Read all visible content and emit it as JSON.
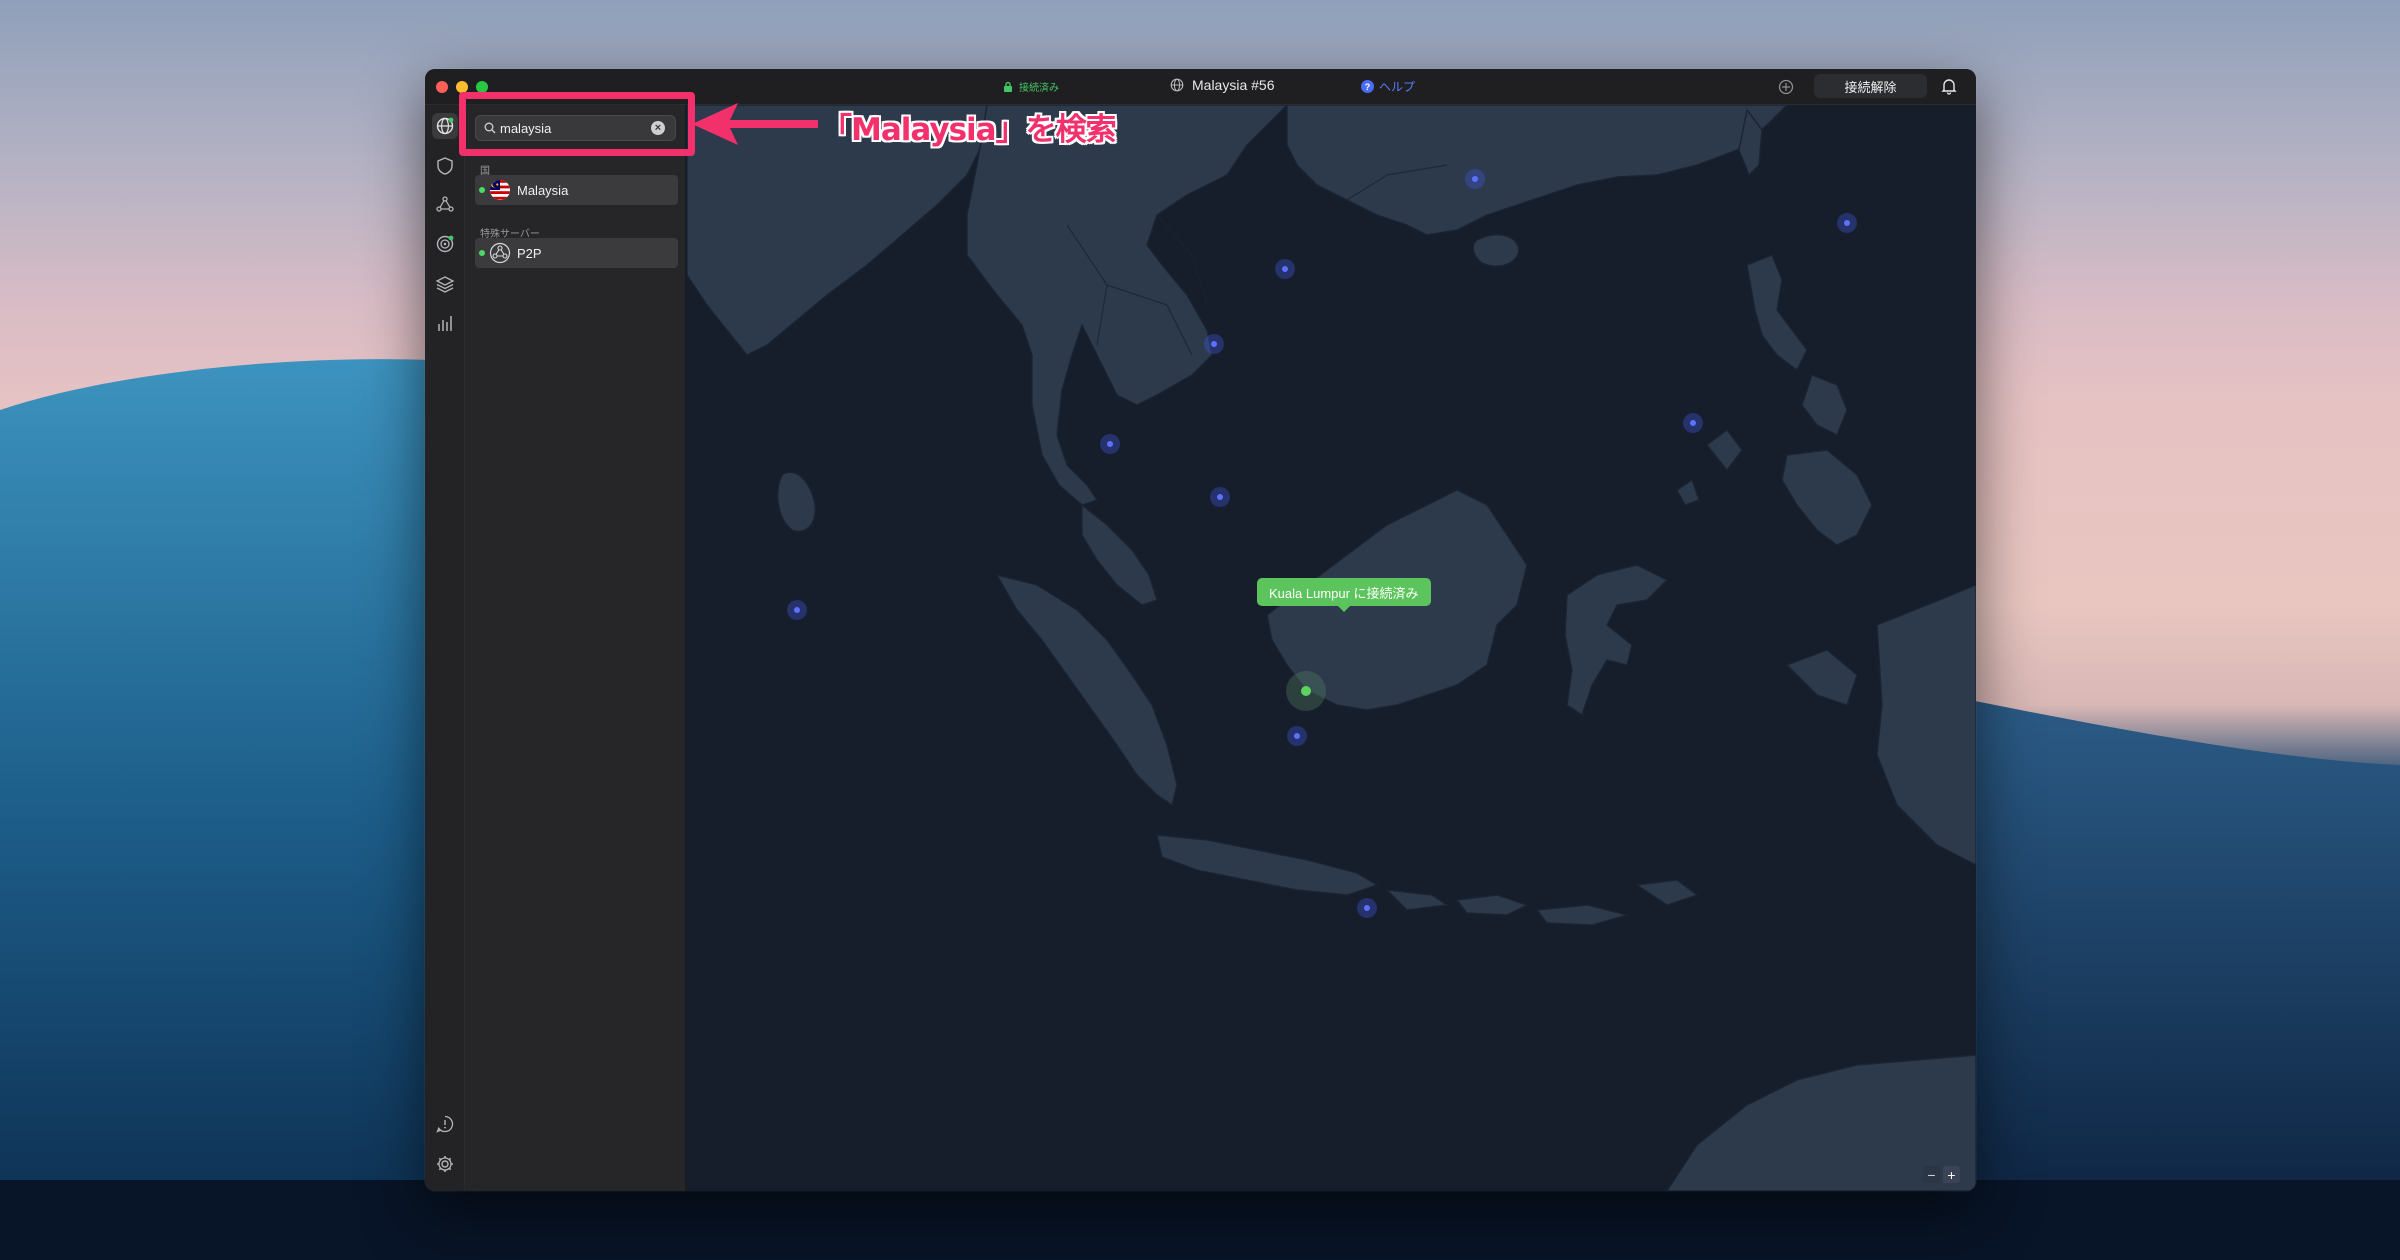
{
  "colors": {
    "accent_connected": "#44c767",
    "server_dot": "#5c72ff",
    "annotation": "#f2316c",
    "map_water": "#151e2a",
    "map_land": "#2c3a4c"
  },
  "titlebar": {
    "status": "接続済み",
    "server_name": "Malaysia #56",
    "help_label": "ヘルプ",
    "disconnect_label": "接続解除"
  },
  "rail": {
    "items": [
      {
        "icon": "globe-icon"
      },
      {
        "icon": "shield-icon"
      },
      {
        "icon": "meshnet-icon"
      },
      {
        "icon": "target-icon"
      },
      {
        "icon": "layers-icon"
      },
      {
        "icon": "stats-icon"
      }
    ],
    "bottom": [
      {
        "icon": "support-icon"
      },
      {
        "icon": "gear-icon"
      }
    ]
  },
  "search": {
    "value": "malaysia"
  },
  "results": {
    "countries_header": "国",
    "countries": [
      {
        "label": "Malaysia",
        "icon": "malaysia-flag-icon"
      }
    ],
    "special_header": "特殊サーバー",
    "special": [
      {
        "label": "P2P",
        "icon": "p2p-icon"
      }
    ]
  },
  "map": {
    "tooltip": "Kuala Lumpur に接続済み",
    "zoom_out_label": "−",
    "zoom_in_label": "+"
  },
  "annotation": {
    "text": "「Malaysia」を検索"
  }
}
